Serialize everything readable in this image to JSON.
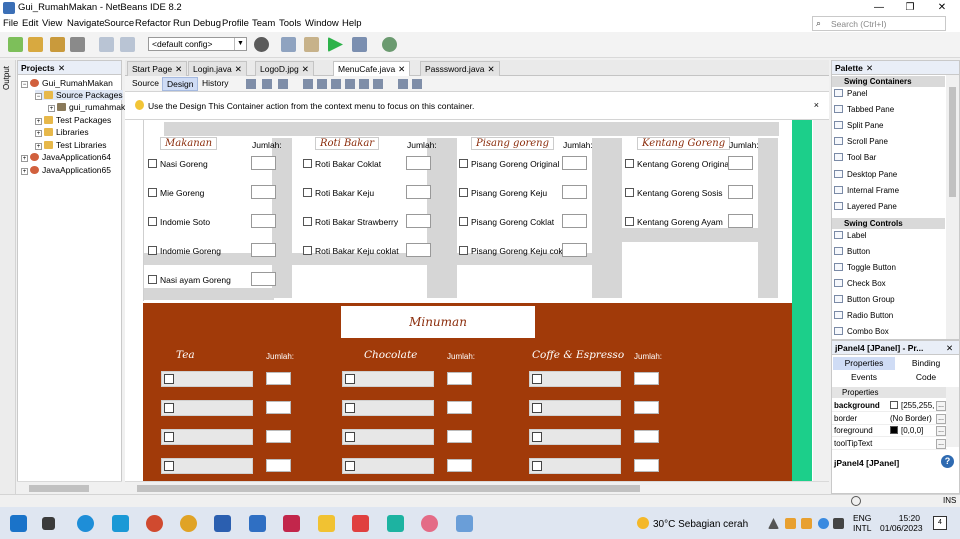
{
  "window": {
    "title": "Gui_RumahMakan - NetBeans IDE 8.2",
    "controls": {
      "minimize": "—",
      "maximize": "❐",
      "close": "✕"
    }
  },
  "menubar": [
    "File",
    "Edit",
    "View",
    "Navigate",
    "Source",
    "Refactor",
    "Run",
    "Debug",
    "Profile",
    "Team",
    "Tools",
    "Window",
    "Help"
  ],
  "search": {
    "placeholder": "Search (Ctrl+I)"
  },
  "toolbar": {
    "config": "<default config>"
  },
  "side_strip": {
    "label": "Output"
  },
  "projects": {
    "title": "Projects",
    "close": "✕",
    "tree": [
      {
        "label": "Gui_RumahMakan",
        "toggle": "−",
        "icon": "cup-icon"
      },
      {
        "label": "Source Packages",
        "toggle": "−",
        "icon": "folder-icon"
      },
      {
        "label": "gui_rumahmak",
        "toggle": "+",
        "icon": "package-icon"
      },
      {
        "label": "Test Packages",
        "toggle": "+",
        "icon": "folder-icon"
      },
      {
        "label": "Libraries",
        "toggle": "+",
        "icon": "folder-icon"
      },
      {
        "label": "Test Libraries",
        "toggle": "+",
        "icon": "folder-icon"
      },
      {
        "label": "JavaApplication64",
        "toggle": "+",
        "icon": "cup-icon"
      },
      {
        "label": "JavaApplication65",
        "toggle": "+",
        "icon": "cup-icon"
      }
    ]
  },
  "editor": {
    "tabs": [
      {
        "label": "Start Page",
        "close": "✕"
      },
      {
        "label": "Login.java",
        "close": "✕"
      },
      {
        "label": "LogoD.jpg",
        "close": "✕"
      },
      {
        "label": "MenuCafe.java",
        "close": "✕"
      },
      {
        "label": "Passsword.java",
        "close": "✕"
      }
    ],
    "active_tab": 3,
    "views": [
      "Source",
      "Design",
      "History"
    ],
    "active_view": 1,
    "info": "Use the Design This Container action from the context menu to focus on this container.",
    "info_close": "×"
  },
  "food": {
    "columns": [
      {
        "category": "Makanan",
        "jumlah": "Jumlah:",
        "items": [
          "Nasi Goreng",
          "Mie Goreng",
          "Indomie Soto",
          "Indomie Goreng",
          "Nasi ayam Goreng"
        ]
      },
      {
        "category": "Roti Bakar",
        "jumlah": "Jumlah:",
        "items": [
          "Roti Bakar Coklat",
          "Roti Bakar Keju",
          "Roti Bakar Strawberry",
          "Roti Bakar Keju coklat"
        ]
      },
      {
        "category": "Pisang goreng",
        "jumlah": "Jumlah:",
        "items": [
          "Pisang Goreng Original",
          "Pisang Goreng Keju",
          "Pisang Goreng Coklat",
          "Pisang Goreng Keju coklat"
        ]
      },
      {
        "category": "Kentang Goreng",
        "jumlah": "Jumlah:",
        "items": [
          "Kentang Goreng Original",
          "Kentang Goreng Sosis",
          "Kentang Goreng Ayam"
        ]
      }
    ]
  },
  "drinks": {
    "title": "Minuman",
    "columns": [
      {
        "category": "Tea",
        "jumlah": "Jumlah:",
        "rows": 4
      },
      {
        "category": "Chocolate",
        "jumlah": "Jumlah:",
        "rows": 4
      },
      {
        "category": "Coffe & Espresso",
        "jumlah": "Jumlah:",
        "rows": 4
      }
    ]
  },
  "palette": {
    "title": "Palette",
    "close": "✕",
    "categories": [
      {
        "label": "Swing Containers",
        "items": [
          "Panel",
          "Tabbed Pane",
          "Split Pane",
          "Scroll Pane",
          "Tool Bar",
          "Desktop Pane",
          "Internal Frame",
          "Layered Pane"
        ]
      },
      {
        "label": "Swing Controls",
        "items": [
          "Label",
          "Button",
          "Toggle Button",
          "Check Box",
          "Button Group",
          "Radio Button",
          "Combo Box"
        ]
      }
    ]
  },
  "properties": {
    "title": "jPanel4 [JPanel] - Pr...",
    "close": "✕",
    "tabs": [
      "Properties",
      "Binding",
      "Events",
      "Code"
    ],
    "section": "Properties",
    "rows": [
      {
        "key": "background",
        "value": "[255,255,",
        "swatch": "#ffffff"
      },
      {
        "key": "border",
        "value": "(No Border)"
      },
      {
        "key": "foreground",
        "value": "[0,0,0]",
        "swatch": "#000000"
      },
      {
        "key": "toolTipText",
        "value": ""
      }
    ],
    "footer": "jPanel4 [JPanel]",
    "help": "?"
  },
  "statusbar": {
    "ins": "INS"
  },
  "taskbar": {
    "weather": "30°C  Sebagian cerah",
    "lang_line1": "ENG",
    "lang_line2": "INTL",
    "time": "15:20",
    "date": "01/06/2023",
    "notifications": "4"
  },
  "colors": {
    "drink_panel": "#a13a09",
    "accent_green": "#1ccf8a",
    "category_text": "#8b2d0c"
  }
}
